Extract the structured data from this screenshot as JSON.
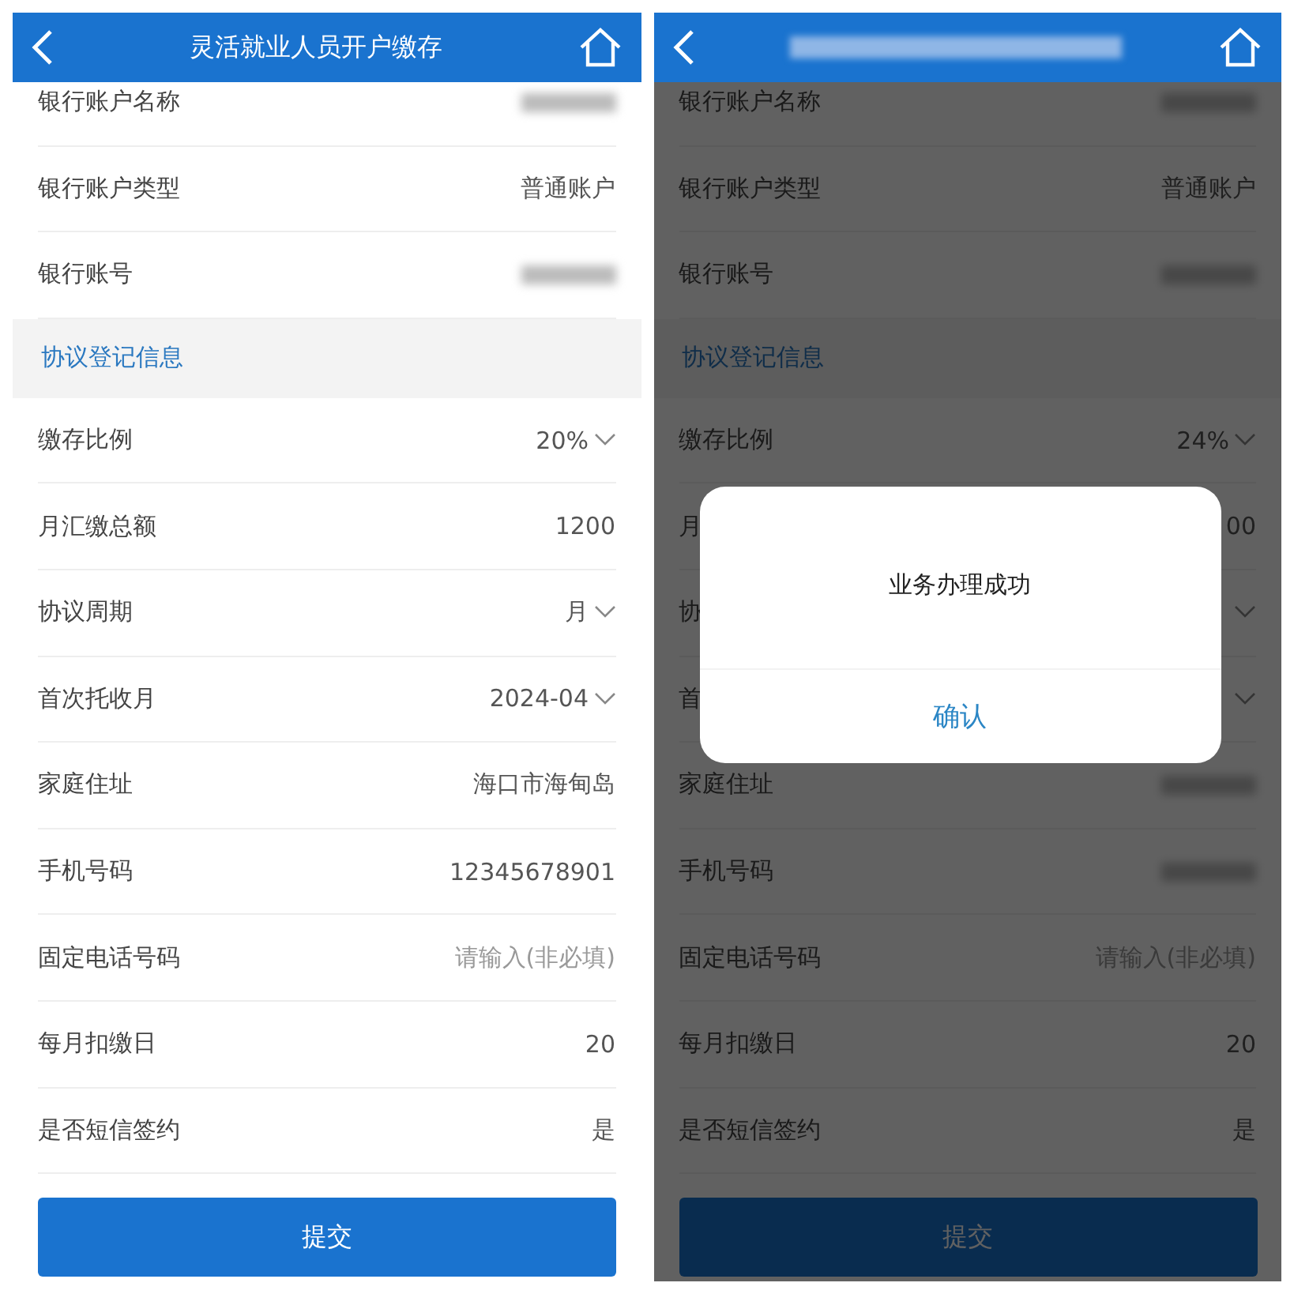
{
  "screens": [
    {
      "title": "灵活就业人员开户缴存",
      "rows": [
        {
          "kind": "field",
          "label": "银行账户名称",
          "redacted": true
        },
        {
          "kind": "field",
          "label": "银行账户类型",
          "value": "普通账户"
        },
        {
          "kind": "field",
          "label": "银行账号",
          "redacted": true
        },
        {
          "kind": "section",
          "label": "协议登记信息"
        },
        {
          "kind": "field",
          "label": "缴存比例",
          "value": "20%",
          "dropdown": true
        },
        {
          "kind": "field",
          "label": "月汇缴总额",
          "value": "1200"
        },
        {
          "kind": "field",
          "label": "协议周期",
          "value": "月",
          "dropdown": true
        },
        {
          "kind": "field",
          "label": "首次托收月",
          "value": "2024-04",
          "dropdown": true
        },
        {
          "kind": "field",
          "label": "家庭住址",
          "value": "海口市海甸岛"
        },
        {
          "kind": "field",
          "label": "手机号码",
          "value": "12345678901"
        },
        {
          "kind": "input",
          "label": "固定电话号码",
          "placeholder": "请输入(非必填)"
        },
        {
          "kind": "field",
          "label": "每月扣缴日",
          "value": "20"
        },
        {
          "kind": "field",
          "label": "是否短信签约",
          "value": "是"
        }
      ],
      "submit": "提交"
    },
    {
      "title_redacted": true,
      "dimmed": true,
      "rows": [
        {
          "kind": "field",
          "label": "银行账户名称",
          "redacted": true
        },
        {
          "kind": "field",
          "label": "银行账户类型",
          "value": "普通账户"
        },
        {
          "kind": "field",
          "label": "银行账号",
          "redacted": true
        },
        {
          "kind": "section",
          "label": "协议登记信息"
        },
        {
          "kind": "field",
          "label": "缴存比例",
          "value": "24%",
          "dropdown": true
        },
        {
          "kind": "field",
          "label": "月",
          "value": "00"
        },
        {
          "kind": "field",
          "label": "协",
          "dropdown": true
        },
        {
          "kind": "field",
          "label": "首",
          "dropdown": true
        },
        {
          "kind": "field",
          "label": "家庭住址",
          "redacted": true
        },
        {
          "kind": "field",
          "label": "手机号码",
          "redacted": true
        },
        {
          "kind": "input",
          "label": "固定电话号码",
          "placeholder": "请输入(非必填)"
        },
        {
          "kind": "field",
          "label": "每月扣缴日",
          "value": "20"
        },
        {
          "kind": "field",
          "label": "是否短信签约",
          "value": "是"
        }
      ],
      "submit": "提交",
      "dialog": {
        "message": "业务办理成功",
        "confirm": "确认"
      }
    }
  ]
}
